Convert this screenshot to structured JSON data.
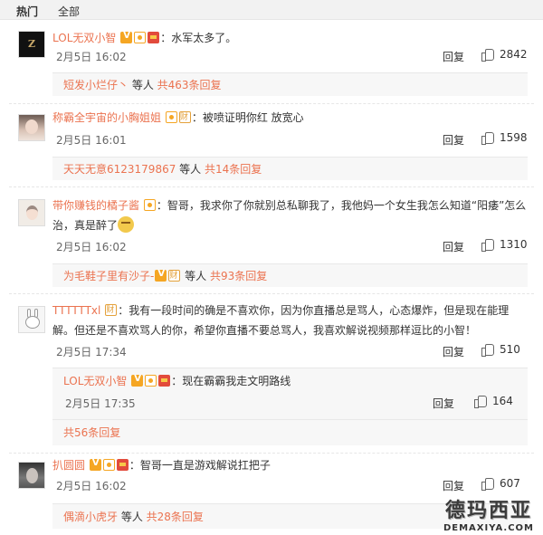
{
  "tabs": {
    "hot": "热门",
    "all": "全部"
  },
  "comments": [
    {
      "user": "LOL无双小智",
      "text": "：水军太多了。",
      "time": "2月5日 16:02",
      "reply_label": "回复",
      "likes": "2842",
      "sub_user": "短发小烂仔丶",
      "sub_mid": " 等人 ",
      "sub_count": "共463条回复"
    },
    {
      "user": "称霸全宇宙的小胸姐姐",
      "text": "：被喷证明你红 放宽心",
      "time": "2月5日 16:01",
      "reply_label": "回复",
      "likes": "1598",
      "sub_user": "天天无意6123179867",
      "sub_mid": " 等人 ",
      "sub_count": "共14条回复"
    },
    {
      "user": "带你赚钱的橘子酱",
      "text_line1": "：智哥，我求你了你就别总私聊我了，我他妈一个女生我怎么知道“阳痿”怎么",
      "text_line2": "治，真是醉了",
      "time": "2月5日 16:02",
      "reply_label": "回复",
      "likes": "1310",
      "sub_user": "为毛鞋子里有沙子-",
      "sub_mid": " 等人 ",
      "sub_count": "共93条回复"
    },
    {
      "user": "TTTTTTxl",
      "text_line1": "：我有一段时间的确是不喜欢你，因为你直播总是骂人，心态爆炸，但是现在能理",
      "text_line2": "解。但还是不喜欢骂人的你，希望你直播不要总骂人，我喜欢解说视频那样逗比的小智！",
      "time": "2月5日 17:34",
      "reply_label": "回复",
      "likes": "510",
      "nested": {
        "user": "LOL无双小智",
        "text": "：现在霸霸我走文明路线",
        "time": "2月5日 17:35",
        "reply_label": "回复",
        "likes": "164"
      },
      "sub_count": "共56条回复"
    },
    {
      "user": "扒圆圆",
      "text": "：智哥一直是游戏解说扛把子",
      "time": "2月5日 16:02",
      "reply_label": "回复",
      "likes": "607",
      "sub_user": "偶滴小虎牙",
      "sub_mid": " 等人 ",
      "sub_count": "共28条回复"
    }
  ],
  "watermark": {
    "title": "德玛西亚",
    "url": "DEMAXIYA.COM"
  },
  "colors": {
    "username": "#eb7350",
    "tab_bar": "#f2f2f2",
    "sub_bg": "#f7f7f7"
  }
}
